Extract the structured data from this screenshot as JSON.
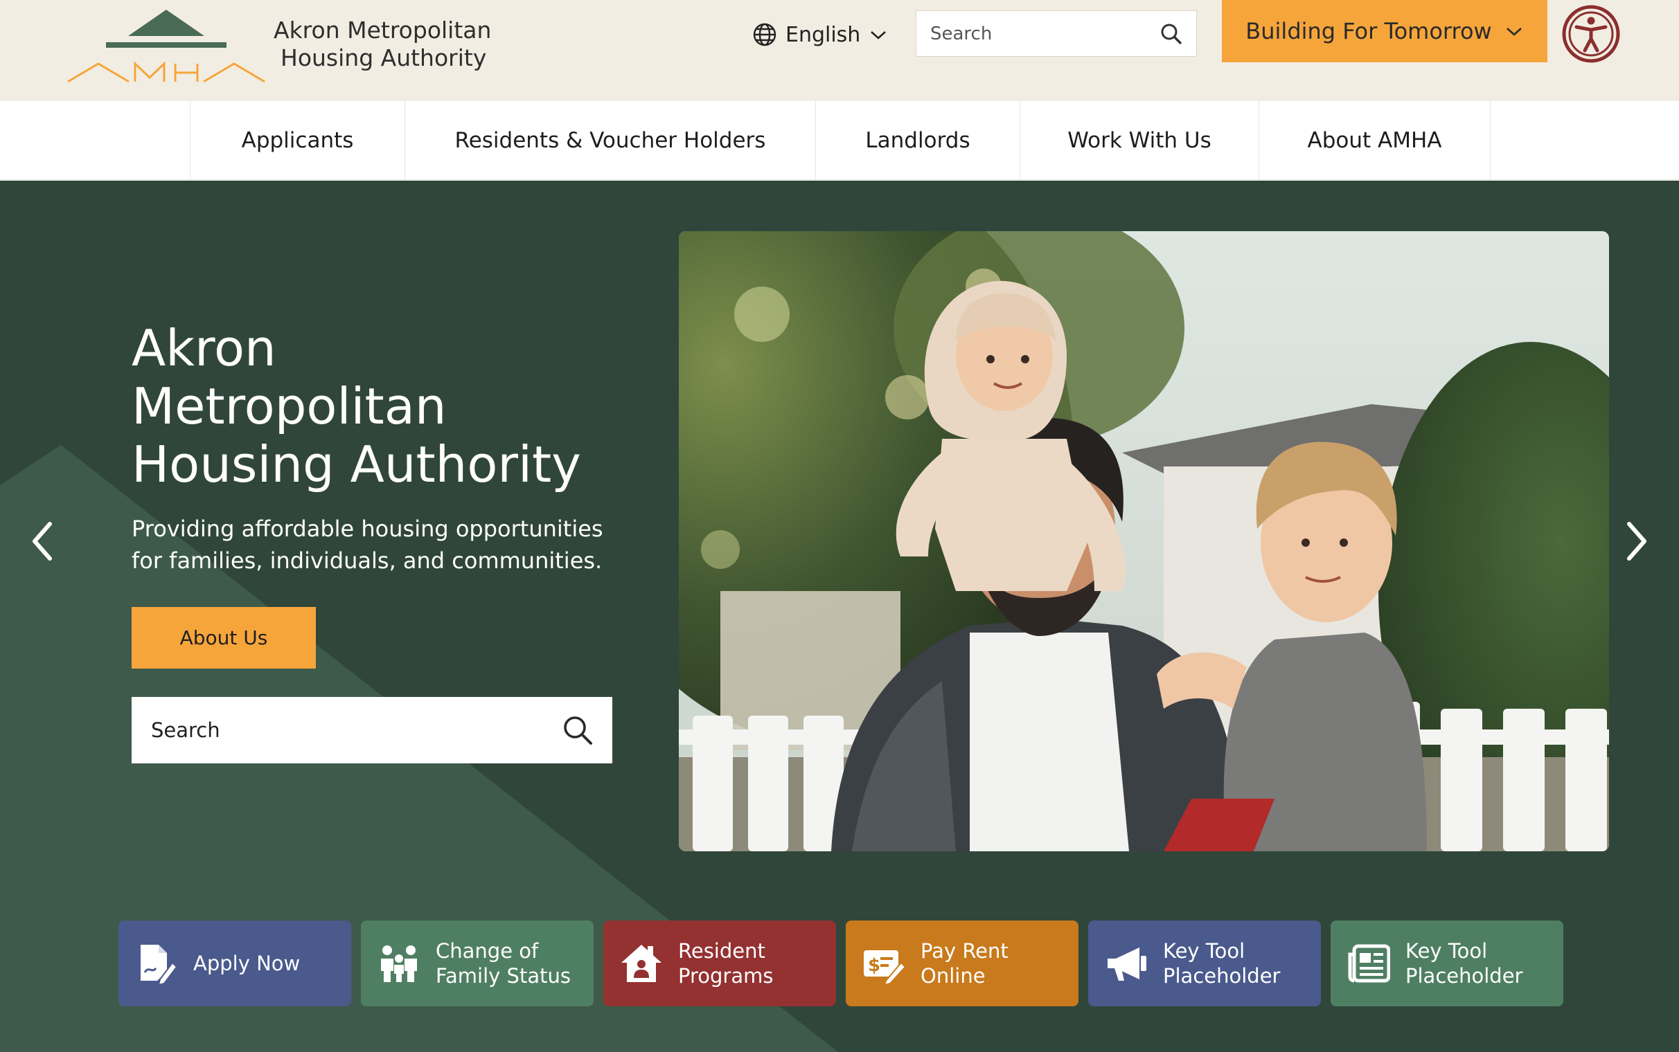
{
  "header": {
    "org_name_line1": "Akron Metropolitan",
    "org_name_line2": "Housing Authority",
    "logo_text": "AMHA",
    "language": "English",
    "search_placeholder": "Search",
    "cta_label": "Building For Tomorrow"
  },
  "nav": {
    "items": [
      {
        "label": "Applicants"
      },
      {
        "label": "Residents & Voucher Holders"
      },
      {
        "label": "Landlords"
      },
      {
        "label": "Work With Us"
      },
      {
        "label": "About AMHA"
      }
    ]
  },
  "hero": {
    "title_line1": "Akron",
    "title_line2": "Metropolitan",
    "title_line3": "Housing Authority",
    "subtitle": "Providing affordable housing opportunities for families, individuals, and communities.",
    "button_label": "About Us",
    "search_placeholder": "Search"
  },
  "tiles": [
    {
      "label": "Apply Now",
      "icon": "apply-document-icon",
      "color": "#4a5a8c"
    },
    {
      "label": "Change of\nFamily Status",
      "icon": "family-icon",
      "color": "#4f7f62"
    },
    {
      "label": "Resident\nPrograms",
      "icon": "house-people-icon",
      "color": "#943131"
    },
    {
      "label": "Pay Rent\nOnline",
      "icon": "pay-rent-icon",
      "color": "#c87a1c"
    },
    {
      "label": "Key Tool\nPlaceholder",
      "icon": "megaphone-icon",
      "color": "#4a5a8c"
    },
    {
      "label": "Key Tool\nPlaceholder",
      "icon": "newspaper-icon",
      "color": "#4f7f62"
    }
  ],
  "colors": {
    "header_bg": "#f2ede2",
    "accent_orange": "#f6a53b",
    "hero_bg": "#30463b",
    "logo_green": "#4a6b55",
    "accessibility_red": "#8b2e2e"
  }
}
